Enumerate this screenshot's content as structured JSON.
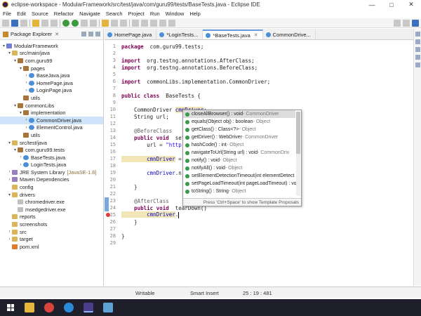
{
  "window": {
    "title": "eclipse-workspace - ModularFramework/src/test/java/com/guru99/tests/BaseTests.java - Eclipse IDE",
    "minimize": "—",
    "maximize": "□",
    "close": "✕"
  },
  "menu": [
    "File",
    "Edit",
    "Source",
    "Refactor",
    "Navigate",
    "Search",
    "Project",
    "Run",
    "Window",
    "Help"
  ],
  "explorer": {
    "title": "Package Explorer",
    "close": "✕",
    "tree": [
      {
        "label": "ModularFramework",
        "arrow": "▾",
        "icon": "proj",
        "indent": 0
      },
      {
        "label": "src/main/java",
        "arrow": "▾",
        "icon": "folder",
        "indent": 1
      },
      {
        "label": "com.guru99",
        "arrow": "▾",
        "icon": "pkg",
        "indent": 2
      },
      {
        "label": "pages",
        "arrow": "▾",
        "icon": "pkg",
        "indent": 3
      },
      {
        "label": "BaseJava.java",
        "arrow": "›",
        "icon": "java",
        "indent": 4
      },
      {
        "label": "HomePage.java",
        "arrow": "›",
        "icon": "java",
        "indent": 4
      },
      {
        "label": "LoginPage.java",
        "arrow": "›",
        "icon": "java",
        "indent": 4
      },
      {
        "label": "utils",
        "arrow": "",
        "icon": "pkg",
        "indent": 3
      },
      {
        "label": "commonLibs",
        "arrow": "▾",
        "icon": "pkg",
        "indent": 2
      },
      {
        "label": "implementation",
        "arrow": "▾",
        "icon": "pkg",
        "indent": 3
      },
      {
        "label": "CommonDriver.java",
        "arrow": "›",
        "icon": "java",
        "indent": 4,
        "selected": true
      },
      {
        "label": "ElementControl.java",
        "arrow": "›",
        "icon": "java",
        "indent": 4
      },
      {
        "label": "utils",
        "arrow": "",
        "icon": "pkg",
        "indent": 3
      },
      {
        "label": "src/test/java",
        "arrow": "▾",
        "icon": "folder",
        "indent": 1
      },
      {
        "label": "com.guru99.tests",
        "arrow": "▾",
        "icon": "pkg",
        "indent": 2
      },
      {
        "label": "BaseTests.java",
        "arrow": "›",
        "icon": "java",
        "indent": 3
      },
      {
        "label": "LoginTests.java",
        "arrow": "›",
        "icon": "java",
        "indent": 3
      },
      {
        "label": "JRE System Library",
        "arrow": "›",
        "icon": "lib",
        "indent": 1,
        "deco": "[JavaSE-1.8]"
      },
      {
        "label": "Maven Dependencies",
        "arrow": "›",
        "icon": "lib",
        "indent": 1
      },
      {
        "label": "config",
        "arrow": "",
        "icon": "folder",
        "indent": 1
      },
      {
        "label": "drivers",
        "arrow": "▾",
        "icon": "folder",
        "indent": 1
      },
      {
        "label": "chromedriver.exe",
        "arrow": "",
        "icon": "file",
        "indent": 2
      },
      {
        "label": "msedgedriver.exe",
        "arrow": "",
        "icon": "file",
        "indent": 2
      },
      {
        "label": "reports",
        "arrow": "",
        "icon": "folder",
        "indent": 1
      },
      {
        "label": "screenshots",
        "arrow": "",
        "icon": "folder",
        "indent": 1
      },
      {
        "label": "src",
        "arrow": "›",
        "icon": "folder",
        "indent": 1
      },
      {
        "label": "target",
        "arrow": "›",
        "icon": "folder",
        "indent": 1
      },
      {
        "label": "pom.xml",
        "arrow": "",
        "icon": "xml",
        "indent": 1
      }
    ]
  },
  "editor": {
    "tabs": [
      {
        "label": "HomePage.java",
        "active": false
      },
      {
        "label": "*LoginTests...",
        "active": false
      },
      {
        "label": "*BaseTests.java",
        "active": true
      },
      {
        "label": "CommonDrive...",
        "active": false
      }
    ],
    "lines": [
      {
        "n": "1",
        "segs": [
          [
            "kw",
            "package"
          ],
          [
            "",
            "  com.guru99.tests;"
          ]
        ]
      },
      {
        "n": "2",
        "segs": []
      },
      {
        "n": "3",
        "segs": [
          [
            "kw",
            "import"
          ],
          [
            "",
            "  org.testng.annotations.AfterClass;"
          ]
        ]
      },
      {
        "n": "4",
        "segs": [
          [
            "kw",
            "import"
          ],
          [
            "",
            "  org.testng.annotations.BeforeClass;"
          ]
        ]
      },
      {
        "n": "5",
        "segs": []
      },
      {
        "n": "6",
        "segs": [
          [
            "kw",
            "import"
          ],
          [
            "",
            "  commonLibs.implementation.CommonDriver;"
          ]
        ]
      },
      {
        "n": "7",
        "segs": []
      },
      {
        "n": "8",
        "segs": [
          [
            "kw",
            "public class"
          ],
          [
            "",
            "  BaseTests {"
          ]
        ]
      },
      {
        "n": "9",
        "segs": []
      },
      {
        "n": "10",
        "segs": [
          [
            "",
            "    CommonDriver "
          ],
          [
            "fld hl",
            "cmnDriver"
          ],
          [
            "",
            ";"
          ]
        ]
      },
      {
        "n": "11",
        "segs": [
          [
            "",
            "    String url;"
          ]
        ]
      },
      {
        "n": "12",
        "segs": []
      },
      {
        "n": "13",
        "segs": [
          [
            "ann",
            "    @BeforeClass"
          ]
        ]
      },
      {
        "n": "14",
        "segs": [
          [
            "kw",
            "    public void"
          ],
          [
            "",
            "  set"
          ]
        ]
      },
      {
        "n": "15",
        "segs": [
          [
            "",
            "        url = "
          ],
          [
            "str",
            "\"http"
          ]
        ]
      },
      {
        "n": "16",
        "segs": []
      },
      {
        "n": "17",
        "segs": [
          [
            "fld hl",
            "        cmnDriver"
          ],
          [
            "",
            " ="
          ]
        ]
      },
      {
        "n": "18",
        "segs": []
      },
      {
        "n": "19",
        "segs": [
          [
            "fld",
            "        cmnDriver"
          ],
          [
            "",
            ".n"
          ]
        ]
      },
      {
        "n": "20",
        "segs": []
      },
      {
        "n": "21",
        "segs": [
          [
            "",
            "    }"
          ]
        ]
      },
      {
        "n": "22",
        "segs": []
      },
      {
        "n": "23",
        "segs": [
          [
            "ann",
            "    @AfterClass"
          ]
        ]
      },
      {
        "n": "24",
        "segs": [
          [
            "kw",
            "    public void"
          ],
          [
            "",
            "  tearDown()"
          ]
        ]
      },
      {
        "n": "25",
        "segs": [
          [
            "fld hl",
            "        cmnDriver"
          ],
          [
            "",
            "."
          ]
        ]
      },
      {
        "n": "26",
        "segs": [
          [
            "",
            "    }"
          ]
        ]
      },
      {
        "n": "27",
        "segs": []
      },
      {
        "n": "28",
        "segs": [
          [
            "",
            "}"
          ]
        ]
      },
      {
        "n": "29",
        "segs": []
      }
    ]
  },
  "proposals": {
    "items": [
      {
        "name": "closeAllBrowser() : void",
        "owner": " - CommonDriver"
      },
      {
        "name": "equals(Object obj) : boolean",
        "owner": " - Object"
      },
      {
        "name": "getClass() : Class<?>",
        "owner": " - Object"
      },
      {
        "name": "getDriver() : WebDriver",
        "owner": " - CommonDriver"
      },
      {
        "name": "hashCode() : int",
        "owner": " - Object"
      },
      {
        "name": "navigateToUrl(String url) : void",
        "owner": " - CommonDriv"
      },
      {
        "name": "notify() : void",
        "owner": " - Object"
      },
      {
        "name": "notifyAll() : void",
        "owner": " - Object"
      },
      {
        "name": "setElementDetectionTimeout(int elementDetect",
        "owner": ""
      },
      {
        "name": "setPageLoadTimeout(int pageLoadTimeout) : vo",
        "owner": ""
      },
      {
        "name": "toString() : String",
        "owner": " - Object"
      }
    ],
    "footer": "Press 'Ctrl+Space' to show Template Proposals"
  },
  "status": {
    "mode": "Writable",
    "insert": "Smart Insert",
    "position": "25 : 19 : 481"
  }
}
